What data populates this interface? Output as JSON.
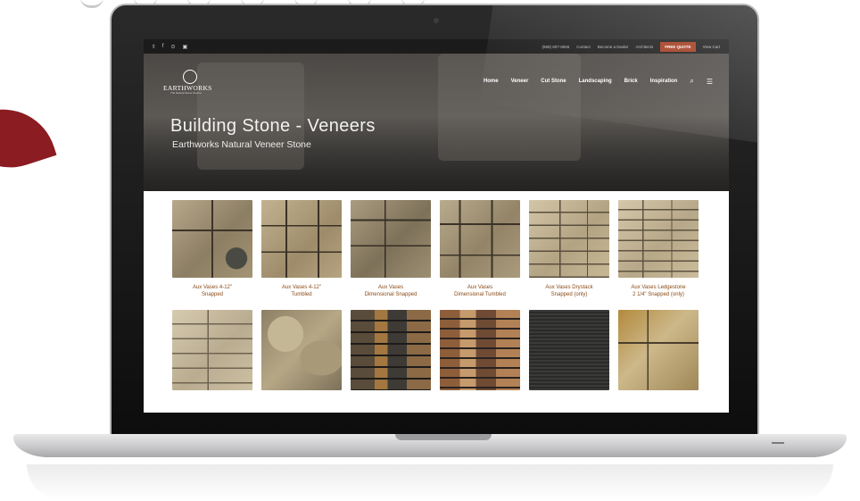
{
  "topbar": {
    "social": [
      "𝕥",
      "f",
      "⊙",
      "▣"
    ],
    "phone": "(888) 807-9555",
    "contact": "Contact",
    "dealer": "Become a Dealer",
    "architects": "Architects",
    "quote": "FREE QUOTE",
    "cart": "View Cart"
  },
  "logo": {
    "text": "EARTHWORKS",
    "tagline": "The Natural Stone Source"
  },
  "nav": [
    "Home",
    "Veneer",
    "Cut Stone",
    "Landscaping",
    "Brick",
    "Inspiration"
  ],
  "hero": {
    "title": "Building Stone - Veneers",
    "subtitle": "Earthworks Natural Veneer Stone"
  },
  "products_row1": [
    "Aux Vases 4-12\"\nSnapped",
    "Aux Vases 4-12\"\nTumbled",
    "Aux Vases\nDimensional Snapped",
    "Aux Vases\nDimensional Tumbled",
    "Aux Vases Drystack\nSnapped (only)",
    "Aux Vases Ledgestone\n2 1/4\" Snapped (only)"
  ],
  "icons": {
    "search": "search-icon",
    "menu": "hamburger-menu-icon"
  },
  "colors": {
    "accent": "#a23a1d",
    "caption": "#8a4a16"
  }
}
